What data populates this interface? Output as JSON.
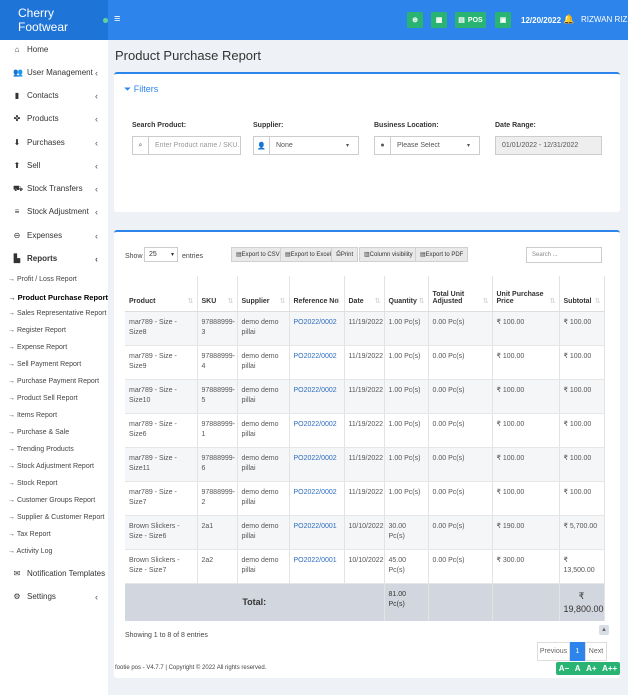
{
  "brand": {
    "name": "Cherry Footwear"
  },
  "topbar": {
    "pos_label": "POS",
    "date": "12/20/2022",
    "user": "RIZWAN RIZ"
  },
  "sidebar": {
    "items": [
      {
        "label": "Home",
        "icon": "home-icon",
        "glyph": "⌂",
        "chevron": false
      },
      {
        "label": "User Management",
        "icon": "users-icon",
        "glyph": "👥",
        "chevron": true
      },
      {
        "label": "Contacts",
        "icon": "contacts-icon",
        "glyph": "▮",
        "chevron": true
      },
      {
        "label": "Products",
        "icon": "products-icon",
        "glyph": "✤",
        "chevron": true
      },
      {
        "label": "Purchases",
        "icon": "purchases-icon",
        "glyph": "⬇",
        "chevron": true
      },
      {
        "label": "Sell",
        "icon": "sell-icon",
        "glyph": "⬆",
        "chevron": true
      },
      {
        "label": "Stock Transfers",
        "icon": "truck-icon",
        "glyph": "⛟",
        "chevron": true
      },
      {
        "label": "Stock Adjustment",
        "icon": "database-icon",
        "glyph": "≡",
        "chevron": true
      },
      {
        "label": "Expenses",
        "icon": "minus-circle-icon",
        "glyph": "⊖",
        "chevron": true
      },
      {
        "label": "Reports",
        "icon": "chart-icon",
        "glyph": "▙",
        "chevron": true
      }
    ],
    "report_links": [
      "→ Profit / Loss Report",
      "→ Product Purchase Report",
      "→ Sales Representative Report",
      "→ Register Report",
      "→ Expense Report",
      "→ Sell Payment Report",
      "→ Purchase Payment Report",
      "→ Product Sell Report",
      "→ Items Report",
      "→ Purchase & Sale",
      "→ Trending Products",
      "→ Stock Adjustment Report",
      "→ Stock Report",
      "→ Customer Groups Report",
      "→ Supplier & Customer Report",
      "→ Tax Report",
      "→ Activity Log"
    ],
    "bottom_items": [
      {
        "label": "Notification Templates",
        "icon": "envelope-icon",
        "glyph": "✉",
        "chevron": false
      },
      {
        "label": "Settings",
        "icon": "cog-icon",
        "glyph": "⚙",
        "chevron": true
      }
    ]
  },
  "page": {
    "title": "Product Purchase Report"
  },
  "filters": {
    "heading": "Filters",
    "search_label": "Search Product:",
    "search_placeholder": "Enter Product name / SKU...",
    "supplier_label": "Supplier:",
    "supplier_value": "None",
    "location_label": "Business Location:",
    "location_value": "Please Select",
    "date_label": "Date Range:",
    "date_value": "01/01/2022 - 12/31/2022"
  },
  "table_controls": {
    "show_label": "Show",
    "show_value": "25",
    "entries_label": "entries",
    "export_csv": "Export to CSV",
    "export_excel": "Export to Excel",
    "print": "Print",
    "column_visibility": "Column visibility",
    "export_pdf": "Export to PDF",
    "search_placeholder": "Search ..."
  },
  "columns": [
    "Product",
    "SKU",
    "Supplier",
    "Reference No",
    "Date",
    "Quantity",
    "Total Unit Adjusted",
    "Unit Purchase Price",
    "Subtotal"
  ],
  "rows": [
    {
      "product": "mar789 - Size - Size8",
      "sku": "97888999-3",
      "supplier": "demo demo pillai",
      "ref": "PO2022/0002",
      "date": "11/19/2022",
      "qty": "1.00 Pc(s)",
      "adjusted": "0.00 Pc(s)",
      "price": "₹ 100.00",
      "subtotal": "₹ 100.00"
    },
    {
      "product": "mar789 - Size - Size9",
      "sku": "97888999-4",
      "supplier": "demo demo pillai",
      "ref": "PO2022/0002",
      "date": "11/19/2022",
      "qty": "1.00 Pc(s)",
      "adjusted": "0.00 Pc(s)",
      "price": "₹ 100.00",
      "subtotal": "₹ 100.00"
    },
    {
      "product": "mar789 - Size - Size10",
      "sku": "97888999-5",
      "supplier": "demo demo pillai",
      "ref": "PO2022/0002",
      "date": "11/19/2022",
      "qty": "1.00 Pc(s)",
      "adjusted": "0.00 Pc(s)",
      "price": "₹ 100.00",
      "subtotal": "₹ 100.00"
    },
    {
      "product": "mar789 - Size - Size6",
      "sku": "97888999-1",
      "supplier": "demo demo pillai",
      "ref": "PO2022/0002",
      "date": "11/19/2022",
      "qty": "1.00 Pc(s)",
      "adjusted": "0.00 Pc(s)",
      "price": "₹ 100.00",
      "subtotal": "₹ 100.00"
    },
    {
      "product": "mar789 - Size - Size11",
      "sku": "97888999-6",
      "supplier": "demo demo pillai",
      "ref": "PO2022/0002",
      "date": "11/19/2022",
      "qty": "1.00 Pc(s)",
      "adjusted": "0.00 Pc(s)",
      "price": "₹ 100.00",
      "subtotal": "₹ 100.00"
    },
    {
      "product": "mar789 - Size - Size7",
      "sku": "97888999-2",
      "supplier": "demo demo pillai",
      "ref": "PO2022/0002",
      "date": "11/19/2022",
      "qty": "1.00 Pc(s)",
      "adjusted": "0.00 Pc(s)",
      "price": "₹ 100.00",
      "subtotal": "₹ 100.00"
    },
    {
      "product": "Brown Slickers - Size - Size6",
      "sku": "2a1",
      "supplier": "demo demo pillai",
      "ref": "PO2022/0001",
      "date": "10/10/2022",
      "qty": "30.00 Pc(s)",
      "adjusted": "0.00 Pc(s)",
      "price": "₹ 190.00",
      "subtotal": "₹ 5,700.00"
    },
    {
      "product": "Brown Slickers - Size - Size7",
      "sku": "2a2",
      "supplier": "demo demo pillai",
      "ref": "PO2022/0001",
      "date": "10/10/2022",
      "qty": "45.00 Pc(s)",
      "adjusted": "0.00 Pc(s)",
      "price": "₹ 300.00",
      "subtotal": "₹ 13,500.00"
    }
  ],
  "totals": {
    "label": "Total:",
    "qty": "81.00 Pc(s)",
    "currency": "₹",
    "subtotal": "19,800.00"
  },
  "pagination": {
    "info": "Showing 1 to 8 of 8 entries",
    "previous": "Previous",
    "current": "1",
    "next": "Next"
  },
  "footer": {
    "text": "footie pos - V4.7.7 | Copyright © 2022 All rights reserved."
  },
  "accessibility": {
    "labels": [
      "A−",
      "A",
      "A+",
      "A++"
    ]
  },
  "colors": {
    "primary": "#2d84eb",
    "brand": "#1f74d7",
    "success": "#29b474",
    "link": "#2d6cc0"
  }
}
